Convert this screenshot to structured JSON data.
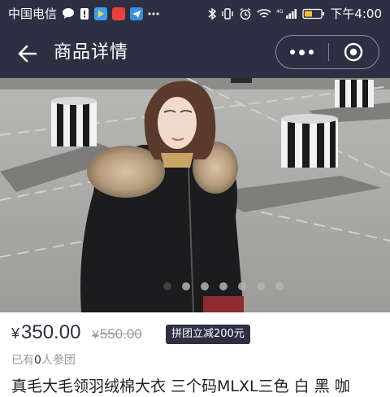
{
  "status_bar": {
    "carrier": "中国电信",
    "time": "下午4:00",
    "network": "4G",
    "left_icons": [
      "chat-icon",
      "alert-icon",
      "play-icon",
      "news-icon",
      "send-icon",
      "more-icon"
    ],
    "right_icons": [
      "bluetooth-icon",
      "vibrate-icon",
      "alarm-icon",
      "wifi-icon",
      "signal-icon",
      "battery-icon"
    ],
    "news_badge": "头条"
  },
  "header": {
    "title": "商品详情",
    "back_icon": "back-arrow-icon",
    "capsule_more_icon": "more-dots-icon",
    "capsule_close_icon": "target-icon",
    "background": "#2f2f44"
  },
  "gallery": {
    "dot_count": 7,
    "active_index": 0
  },
  "product": {
    "currency": "¥",
    "price": "350.00",
    "original_price": "550.00",
    "promo": "拼团立减200元",
    "joined_prefix": "已有",
    "joined_count": "0",
    "joined_suffix": "人参团",
    "title": "真毛大毛领羽绒棉大衣 三个码MLXL三色 白 黑 咖"
  },
  "colors": {
    "accent": "#2f2f44",
    "muted": "#9a9a9a"
  }
}
